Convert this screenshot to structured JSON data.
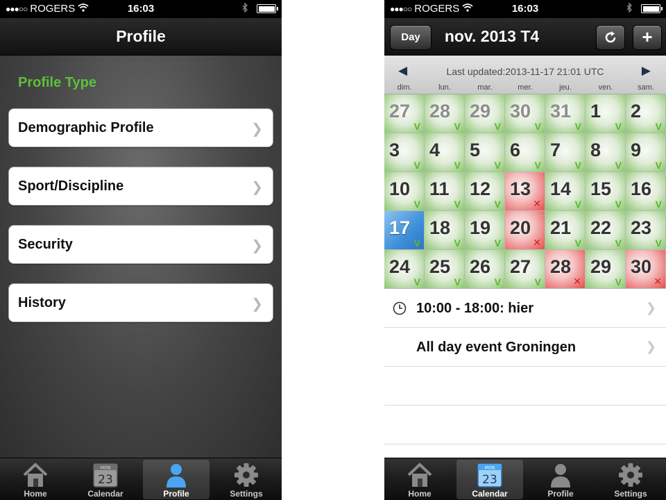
{
  "status_bar": {
    "carrier": "ROGERS",
    "time": "16:03"
  },
  "left_screen": {
    "title": "Profile",
    "section_heading": "Profile Type",
    "menu_items": [
      {
        "label": "Demographic Profile"
      },
      {
        "label": "Sport/Discipline"
      },
      {
        "label": "Security"
      },
      {
        "label": "History"
      }
    ],
    "active_tab": "Profile"
  },
  "right_screen": {
    "title": "nov. 2013 T4",
    "day_button": "Day",
    "last_updated": "Last updated:2013-11-17 21:01 UTC",
    "weekdays": [
      "dim.",
      "lun.",
      "mar.",
      "mer.",
      "jeu.",
      "ven.",
      "sam."
    ],
    "calendar_days": [
      {
        "day": "27",
        "month": "previous",
        "status": "ok"
      },
      {
        "day": "28",
        "month": "previous",
        "status": "ok"
      },
      {
        "day": "29",
        "month": "previous",
        "status": "ok"
      },
      {
        "day": "30",
        "month": "previous",
        "status": "ok"
      },
      {
        "day": "31",
        "month": "previous",
        "status": "ok"
      },
      {
        "day": "1",
        "month": "current",
        "status": "ok"
      },
      {
        "day": "2",
        "month": "current",
        "status": "ok"
      },
      {
        "day": "3",
        "month": "current",
        "status": "ok"
      },
      {
        "day": "4",
        "month": "current",
        "status": "ok"
      },
      {
        "day": "5",
        "month": "current",
        "status": "ok"
      },
      {
        "day": "6",
        "month": "current",
        "status": "ok"
      },
      {
        "day": "7",
        "month": "current",
        "status": "ok"
      },
      {
        "day": "8",
        "month": "current",
        "status": "ok"
      },
      {
        "day": "9",
        "month": "current",
        "status": "ok"
      },
      {
        "day": "10",
        "month": "current",
        "status": "ok"
      },
      {
        "day": "11",
        "month": "current",
        "status": "ok"
      },
      {
        "day": "12",
        "month": "current",
        "status": "ok"
      },
      {
        "day": "13",
        "month": "current",
        "status": "missed"
      },
      {
        "day": "14",
        "month": "current",
        "status": "ok"
      },
      {
        "day": "15",
        "month": "current",
        "status": "ok"
      },
      {
        "day": "16",
        "month": "current",
        "status": "ok"
      },
      {
        "day": "17",
        "month": "current",
        "status": "ok",
        "today": true
      },
      {
        "day": "18",
        "month": "current",
        "status": "ok"
      },
      {
        "day": "19",
        "month": "current",
        "status": "ok"
      },
      {
        "day": "20",
        "month": "current",
        "status": "missed"
      },
      {
        "day": "21",
        "month": "current",
        "status": "ok"
      },
      {
        "day": "22",
        "month": "current",
        "status": "ok"
      },
      {
        "day": "23",
        "month": "current",
        "status": "ok"
      },
      {
        "day": "24",
        "month": "current",
        "status": "ok"
      },
      {
        "day": "25",
        "month": "current",
        "status": "ok"
      },
      {
        "day": "26",
        "month": "current",
        "status": "ok"
      },
      {
        "day": "27",
        "month": "current",
        "status": "ok"
      },
      {
        "day": "28",
        "month": "current",
        "status": "missed"
      },
      {
        "day": "29",
        "month": "current",
        "status": "ok"
      },
      {
        "day": "30",
        "month": "current",
        "status": "missed"
      }
    ],
    "marks": {
      "ok": "V",
      "missed": "✕"
    },
    "events": [
      {
        "text": "10:00 - 18:00: hier",
        "has_clock": true
      },
      {
        "text": "All day event Groningen",
        "has_clock": false
      }
    ],
    "active_tab": "Calendar"
  },
  "tabs": [
    {
      "id": "home",
      "label": "Home"
    },
    {
      "id": "calendar",
      "label": "Calendar",
      "icon_month": "MON",
      "icon_day": "23"
    },
    {
      "id": "profile",
      "label": "Profile"
    },
    {
      "id": "settings",
      "label": "Settings"
    }
  ],
  "colors": {
    "accent_green": "#5cc03c",
    "ok_mark": "#59b82e",
    "missed_mark": "#d42020",
    "today_blue": "#3d8fd9",
    "active_tab_icon": "#4aa6f2"
  }
}
